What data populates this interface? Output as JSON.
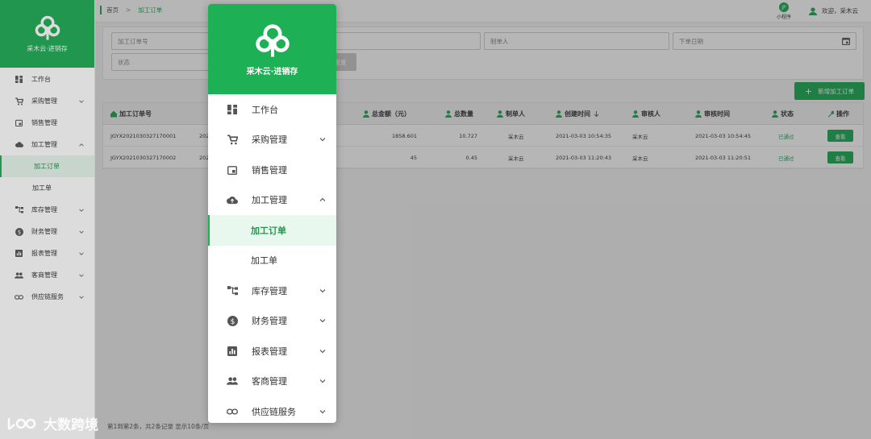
{
  "app": {
    "name": "采木云·进销存"
  },
  "sidebar": {
    "items": [
      {
        "label": "工作台",
        "icon": "dashboard-icon"
      },
      {
        "label": "采购管理",
        "icon": "cart-icon",
        "expandable": true
      },
      {
        "label": "销售管理",
        "icon": "sales-icon"
      },
      {
        "label": "加工管理",
        "icon": "cloud-upload-icon",
        "expandable": true,
        "expanded": true
      },
      {
        "label": "加工订单",
        "sub": true,
        "active": true
      },
      {
        "label": "加工单",
        "sub": true
      },
      {
        "label": "库存管理",
        "icon": "hierarchy-icon",
        "expandable": true
      },
      {
        "label": "财务管理",
        "icon": "dollar-icon",
        "expandable": true
      },
      {
        "label": "报表管理",
        "icon": "report-icon",
        "expandable": true
      },
      {
        "label": "客商管理",
        "icon": "people-icon",
        "expandable": true
      },
      {
        "label": "供应链服务",
        "icon": "link-icon",
        "expandable": true
      }
    ]
  },
  "breadcrumb": {
    "home": "首页",
    "sep": ">",
    "current": "加工订单"
  },
  "header": {
    "mini_badge": "JP",
    "mini_label": "小程序",
    "welcome": "欢迎，采木云"
  },
  "filters": {
    "order_no": "加工订单号",
    "creator": "制单人",
    "order_date": "下单日期",
    "status": "状态",
    "search_btn": "查询",
    "reset_btn": "重置"
  },
  "add_button": "新增加工订单",
  "table": {
    "headers": {
      "order_no": "加工订单号",
      "amount": "总金额（元）",
      "qty": "总数量",
      "creator": "制单人",
      "created": "创建时间",
      "reviewer": "审核人",
      "reviewed": "审核时间",
      "status": "状态",
      "action": "操作"
    },
    "rows": [
      {
        "order_no": "JGYX2021030327170001",
        "date_prefix": "202",
        "amount": "1858.601",
        "qty": "10.727",
        "creator": "采木云",
        "created": "2021-03-03 10:54:35",
        "reviewer": "采木云",
        "reviewed": "2021-03-03 10:54:45",
        "status": "已通过",
        "action": "查看"
      },
      {
        "order_no": "JGYX2021030327170002",
        "date_prefix": "202",
        "amount": "45",
        "qty": "0.45",
        "creator": "采木云",
        "created": "2021-03-03 11:20:43",
        "reviewer": "采木云",
        "reviewed": "2021-03-03 11:20:51",
        "status": "已通过",
        "action": "查看"
      }
    ]
  },
  "pager": {
    "text": "第1到第2条，共2条记录  显示10条/页"
  },
  "watermark": {
    "text": "大数跨境"
  },
  "colors": {
    "brand": "#1aaa52",
    "active_bg": "#e9f8ee"
  }
}
